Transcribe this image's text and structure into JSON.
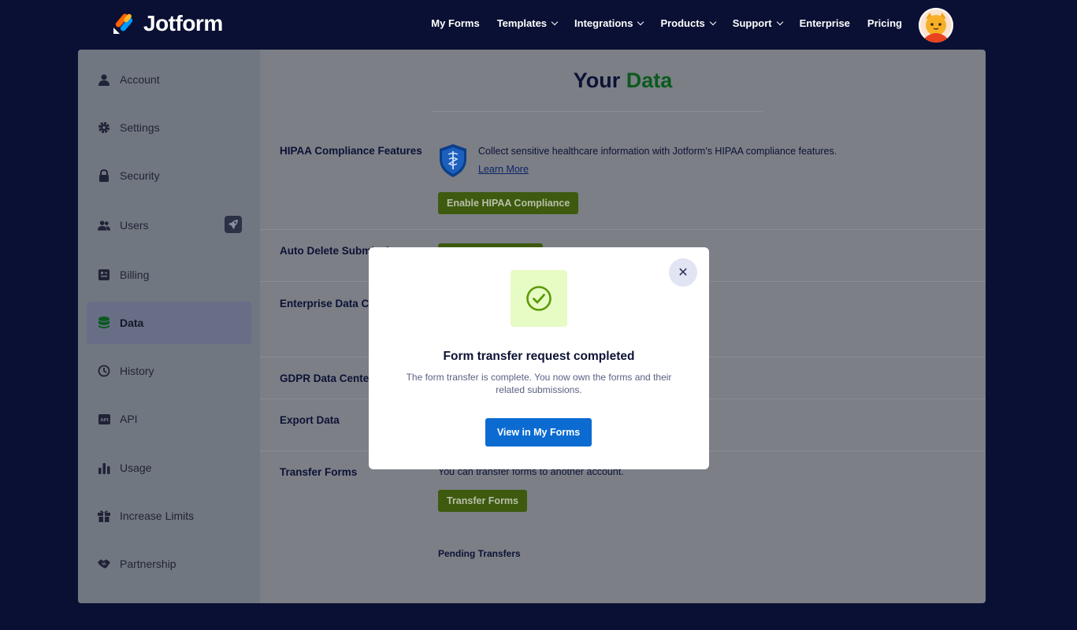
{
  "brand": {
    "name": "Jotform"
  },
  "nav": {
    "my_forms": "My Forms",
    "templates": "Templates",
    "integrations": "Integrations",
    "products": "Products",
    "support": "Support",
    "enterprise": "Enterprise",
    "pricing": "Pricing"
  },
  "sidebar": {
    "items": [
      {
        "label": "Account",
        "icon": "user-icon"
      },
      {
        "label": "Settings",
        "icon": "gear-icon"
      },
      {
        "label": "Security",
        "icon": "lock-icon"
      },
      {
        "label": "Users",
        "icon": "users-icon"
      },
      {
        "label": "Billing",
        "icon": "billing-icon"
      },
      {
        "label": "Data",
        "icon": "database-icon",
        "active": true
      },
      {
        "label": "History",
        "icon": "history-icon"
      },
      {
        "label": "API",
        "icon": "api-icon"
      },
      {
        "label": "Usage",
        "icon": "bar-chart-icon"
      },
      {
        "label": "Increase Limits",
        "icon": "gift-icon"
      },
      {
        "label": "Partnership",
        "icon": "handshake-icon"
      }
    ]
  },
  "page": {
    "title_part1": "Your",
    "title_part2": "Data"
  },
  "sections": {
    "hipaa": {
      "label": "HIPAA Compliance Features",
      "description": "Collect sensitive healthcare information with Jotform's HIPAA compliance features.",
      "learn_more": "Learn More",
      "button": "Enable HIPAA Compliance"
    },
    "auto_delete": {
      "label": "Auto Delete Submissions"
    },
    "enterprise_data": {
      "label": "Enterprise Data Center"
    },
    "gdpr": {
      "label": "GDPR Data Center"
    },
    "export": {
      "label": "Export Data"
    },
    "transfer": {
      "label": "Transfer Forms",
      "description": "You can transfer forms to another account.",
      "button": "Transfer Forms",
      "pending": "Pending Transfers"
    }
  },
  "modal": {
    "title": "Form transfer request completed",
    "description": "The form transfer is complete. You now own the forms and their related submissions.",
    "button": "View in My Forms",
    "close": "✕"
  },
  "colors": {
    "nav_bg": "#0a1033",
    "accent_green": "#78bb07",
    "primary_blue": "#0b6bd1"
  }
}
